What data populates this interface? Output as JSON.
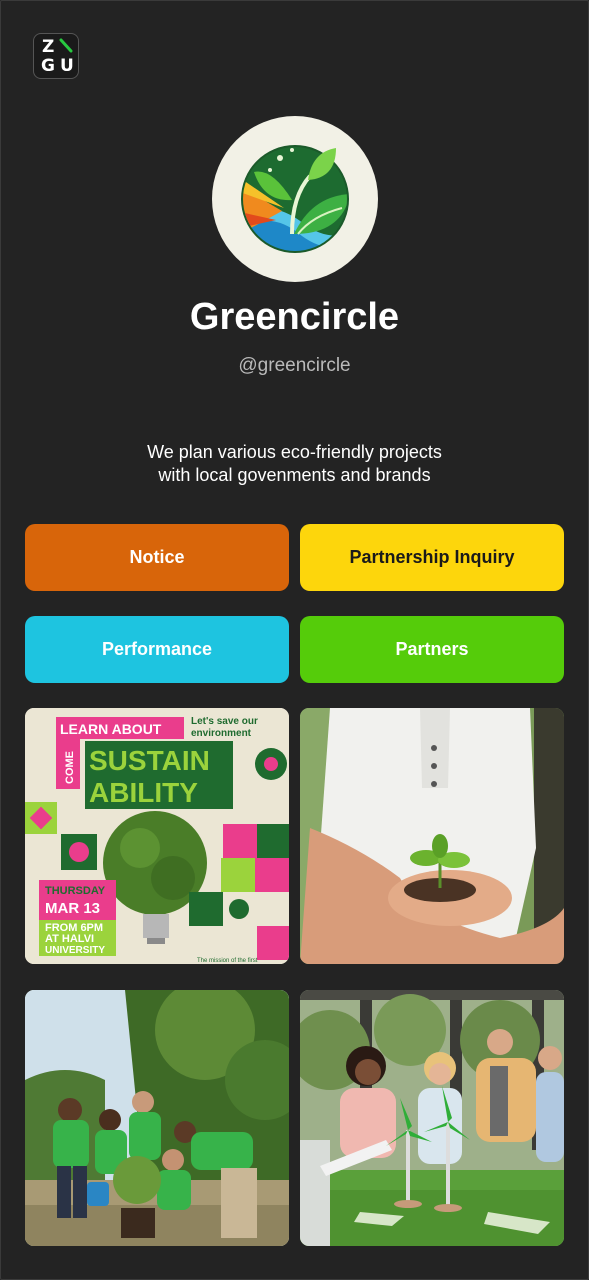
{
  "logo": {
    "letters": [
      "Z",
      "G",
      "U"
    ],
    "accent": "#28c940"
  },
  "profile": {
    "name": "Greencircle",
    "handle": "@greencircle",
    "bio_line1": "We plan various eco-friendly projects",
    "bio_line2": "with local govenments and brands"
  },
  "buttons": [
    {
      "label": "Notice",
      "bg": "#d8650a",
      "color": "#ffffff"
    },
    {
      "label": "Partnership Inquiry",
      "bg": "#fdd60c",
      "color": "#1a1a1a"
    },
    {
      "label": "Performance",
      "bg": "#1ec4e0",
      "color": "#ffffff"
    },
    {
      "label": "Partners",
      "bg": "#55cc0a",
      "color": "#ffffff"
    }
  ],
  "poster": {
    "learn": "LEARN ABOUT",
    "come": "COME",
    "save": "Let's save our",
    "save2": "environment",
    "sustain": "SUSTAIN",
    "ability": "ABILITY",
    "day": "THURSDAY",
    "date": "MAR 13",
    "from": "FROM 6PM",
    "at": "AT HALVI",
    "univ": "UNIVERSITY",
    "footer": "The mission of the first"
  }
}
